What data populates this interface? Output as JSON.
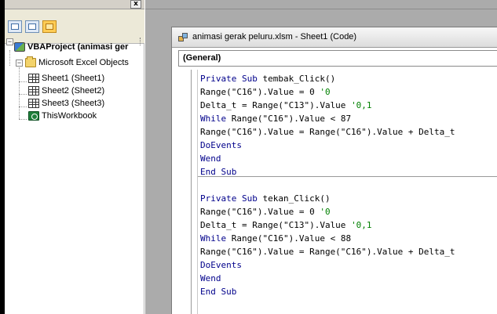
{
  "project_explorer": {
    "close_glyph": "x",
    "tree": {
      "project": "VBAProject (animasi ger",
      "folder": "Microsoft Excel Objects",
      "items": [
        "Sheet1 (Sheet1)",
        "Sheet2 (Sheet2)",
        "Sheet3 (Sheet3)",
        "ThisWorkbook"
      ]
    }
  },
  "code_window": {
    "title": "animasi gerak peluru.xlsm - Sheet1 (Code)",
    "object_combo": "(General)",
    "procedures": [
      {
        "lines": [
          [
            {
              "t": "Private Sub ",
              "k": true
            },
            {
              "t": "tembak_Click()"
            }
          ],
          [
            {
              "t": "Range(\"C16\").Value = 0 "
            },
            {
              "t": "'0",
              "c": true
            }
          ],
          [
            {
              "t": "Delta_t = Range(\"C13\").Value "
            },
            {
              "t": "'0,1",
              "c": true
            }
          ],
          [
            {
              "t": "While ",
              "k": true
            },
            {
              "t": "Range(\"C16\").Value < 87"
            }
          ],
          [
            {
              "t": "Range(\"C16\").Value = Range(\"C16\").Value + Delta_t"
            }
          ],
          [
            {
              "t": "DoEvents",
              "k": true
            }
          ],
          [
            {
              "t": "Wend",
              "k": true
            }
          ],
          [
            {
              "t": "End Sub",
              "k": true
            }
          ]
        ]
      },
      {
        "lines": [
          [
            {
              "t": "Private Sub ",
              "k": true
            },
            {
              "t": "tekan_Click()"
            }
          ],
          [
            {
              "t": "Range(\"C16\").Value = 0 "
            },
            {
              "t": "'0",
              "c": true
            }
          ],
          [
            {
              "t": "Delta_t = Range(\"C13\").Value "
            },
            {
              "t": "'0,1",
              "c": true
            }
          ],
          [
            {
              "t": "While ",
              "k": true
            },
            {
              "t": "Range(\"C16\").Value < 88"
            }
          ],
          [
            {
              "t": "Range(\"C16\").Value = Range(\"C16\").Value + Delta_t"
            }
          ],
          [
            {
              "t": "DoEvents",
              "k": true
            }
          ],
          [
            {
              "t": "Wend",
              "k": true
            }
          ],
          [
            {
              "t": "End Sub",
              "k": true
            }
          ]
        ]
      }
    ]
  },
  "colors": {
    "keyword": "#00008b",
    "comment": "#008000",
    "mdi_background": "#ababab"
  }
}
